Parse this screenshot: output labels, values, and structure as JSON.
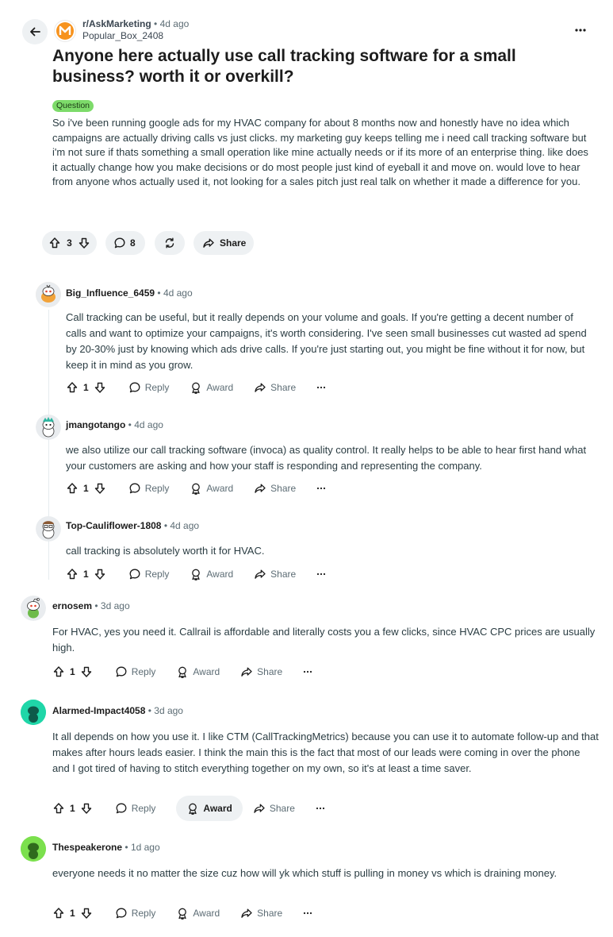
{
  "post": {
    "subreddit": "r/AskMarketing",
    "age": "4d ago",
    "author": "Popular_Box_2408",
    "title": "Anyone here actually use call tracking software for a small business? worth it or overkill?",
    "flair": "Question",
    "body": "So i've been running google ads for my HVAC company for about 8 months now and honestly have no idea which campaigns are actually driving calls vs just clicks. my marketing guy keeps telling me i need call tracking software but i'm not sure if thats something a small operation like mine actually needs or if its more of an enterprise thing. like does it actually change how you make decisions or do most people just kind of eyeball it and move on. would love to hear from anyone whos actually used it, not looking for a sales pitch just real talk on whether it made a difference for you.",
    "votes": "3",
    "comments": "8",
    "share_label": "Share"
  },
  "labels": {
    "reply": "Reply",
    "award": "Award",
    "share": "Share",
    "dot": "•",
    "more": "···"
  },
  "comments": [
    {
      "author": "Big_Influence_6459",
      "age": "4d ago",
      "votes": "1",
      "avatar_color": "#f2a33a",
      "text": "Call tracking can be useful, but it really depends on your volume and goals. If you're getting a decent number of calls and want to optimize your campaigns, it's worth considering. I've seen small businesses cut wasted ad spend by 20-30% just by knowing which ads drive calls. If you're just starting out, you might be fine without it for now, but keep it in mind as you grow."
    },
    {
      "author": "jmangotango",
      "age": "4d ago",
      "votes": "1",
      "avatar_color": "#2fb6a1",
      "text": "we also utilize our call tracking software (invoca) as quality control. It really helps to be able to hear first hand what your customers are asking and how your staff is responding and representing the company."
    },
    {
      "author": "Top-Cauliflower-1808",
      "age": "4d ago",
      "votes": "1",
      "avatar_color": "#c9a27a",
      "text": "call tracking is absolutely worth it for HVAC."
    },
    {
      "author": "ernosem",
      "age": "3d ago",
      "votes": "1",
      "avatar_color": "#6dbb4a",
      "text": "For HVAC, yes you need it. Callrail is affordable and literally costs you a few clicks, since HVAC CPC prices are usually high."
    },
    {
      "author": "Alarmed-Impact4058",
      "age": "3d ago",
      "votes": "1",
      "avatar_color": "#1fd6a8",
      "text": "It all depends on how you use it. I like CTM (CallTrackingMetrics) because you can use it to automate follow-up and that makes after hours leads easier. I think the main this is the fact that most of our leads were coming in over the phone and I got tired of having to stitch everything together on my own, so it's at least a time saver."
    },
    {
      "author": "Thespeakerone",
      "age": "1d ago",
      "votes": "1",
      "avatar_color": "#7be04d",
      "text": "everyone needs it no matter the size cuz how will yk which stuff is pulling in money vs which is draining money."
    }
  ]
}
